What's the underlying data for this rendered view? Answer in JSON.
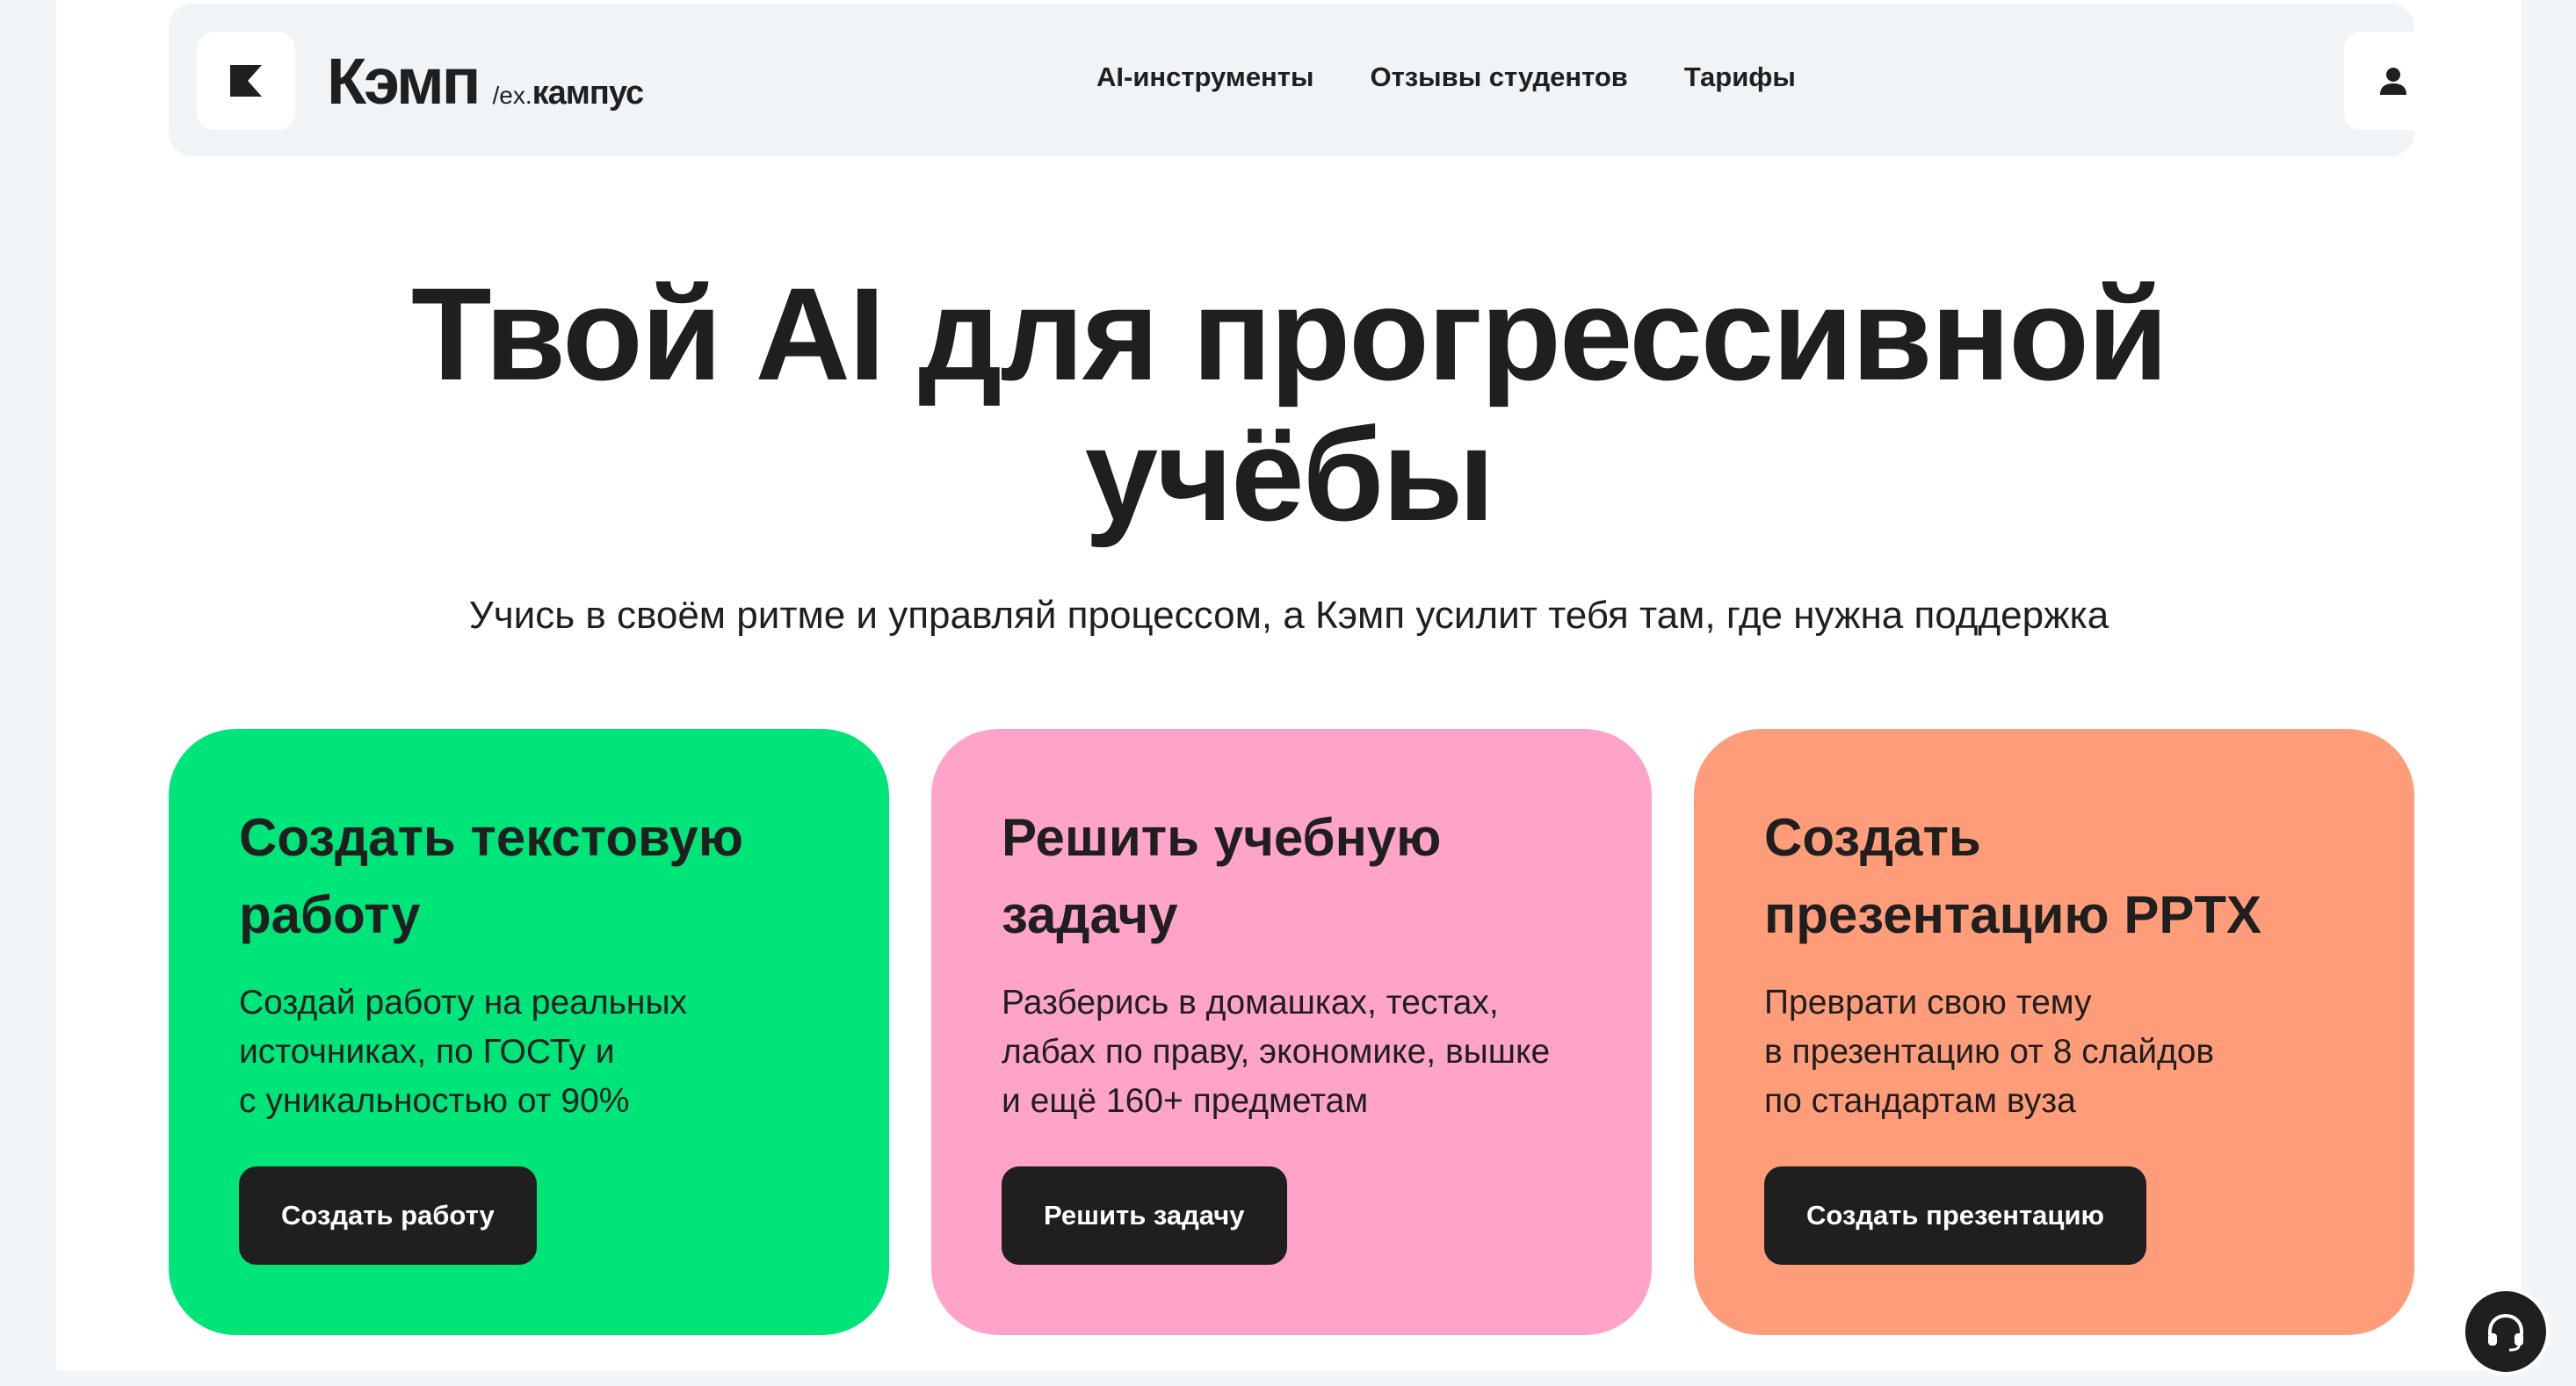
{
  "header": {
    "brand_name": "Кэмп",
    "brand_ex_prefix": "/ex.",
    "brand_ex_name": "кампус",
    "nav": [
      {
        "label": "AI-инструменты"
      },
      {
        "label": "Отзывы студентов"
      },
      {
        "label": "Тарифы"
      }
    ]
  },
  "hero": {
    "title_line1": "Твой AI для прогрессивной",
    "title_line2": "учёбы",
    "subtitle": "Учись в своём ритме и управляй процессом, а Кэмп усилит тебя там, где нужна поддержка"
  },
  "cards": [
    {
      "title_line1": "Создать текстовую",
      "title_line2": "работу",
      "desc_line1": "Создай работу на реальных",
      "desc_line2": "источниках, по ГОСТу и",
      "desc_line3": "с уникальностью от 90%",
      "button": "Создать работу"
    },
    {
      "title_line1": "Решить учебную",
      "title_line2": "задачу",
      "desc_line1": "Разберись в домашках, тестах,",
      "desc_line2": "лабах по праву, экономике, вышке",
      "desc_line3": "и ещё 160+ предметам",
      "button": "Решить задачу"
    },
    {
      "title_line1": "Создать",
      "title_line2": "презентацию PPTX",
      "desc_line1": "Преврати свою тему",
      "desc_line2": "в презентацию от 8 слайдов",
      "desc_line3": "по стандартам вуза",
      "button": "Создать презентацию"
    }
  ],
  "colors": {
    "green": "#00e57a",
    "pink": "#ffa3c8",
    "orange": "#ff9c7a",
    "dark": "#1f1f1f"
  },
  "icons": {
    "logo": "k-logo-icon",
    "profile": "user-icon",
    "support": "headset-icon"
  }
}
